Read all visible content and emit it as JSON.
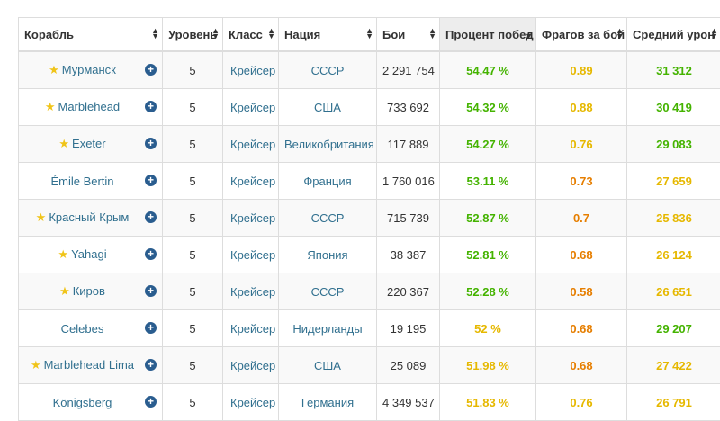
{
  "headers": {
    "ship": "Корабль",
    "level": "Уровень",
    "class": "Класс",
    "nation": "Нация",
    "battles": "Бои",
    "winrate": "Процент побед",
    "frags": "Фрагов за бой",
    "avgdmg": "Средний урон"
  },
  "colors": {
    "green": "#44b300",
    "yellow": "#e6b800",
    "orange": "#e67e00",
    "link": "#31708f",
    "star": "#f0c419",
    "plus": "#2a5d8f"
  },
  "rows": [
    {
      "premium": true,
      "ship": "Мурманск",
      "level": "5",
      "class": "Крейсер",
      "nation": "СССР",
      "battles": "2 291 754",
      "winrate": "54.47 %",
      "winrate_color": "green",
      "frags": "0.89",
      "frags_color": "yellow",
      "avgdmg": "31 312",
      "avgdmg_color": "green"
    },
    {
      "premium": true,
      "ship": "Marblehead",
      "level": "5",
      "class": "Крейсер",
      "nation": "США",
      "battles": "733 692",
      "winrate": "54.32 %",
      "winrate_color": "green",
      "frags": "0.88",
      "frags_color": "yellow",
      "avgdmg": "30 419",
      "avgdmg_color": "green"
    },
    {
      "premium": true,
      "ship": "Exeter",
      "level": "5",
      "class": "Крейсер",
      "nation": "Великобритания",
      "battles": "117 889",
      "winrate": "54.27 %",
      "winrate_color": "green",
      "frags": "0.76",
      "frags_color": "yellow",
      "avgdmg": "29 083",
      "avgdmg_color": "green"
    },
    {
      "premium": false,
      "ship": "Émile Bertin",
      "level": "5",
      "class": "Крейсер",
      "nation": "Франция",
      "battles": "1 760 016",
      "winrate": "53.11 %",
      "winrate_color": "green",
      "frags": "0.73",
      "frags_color": "orange",
      "avgdmg": "27 659",
      "avgdmg_color": "yellow"
    },
    {
      "premium": true,
      "ship": "Красный Крым",
      "level": "5",
      "class": "Крейсер",
      "nation": "СССР",
      "battles": "715 739",
      "winrate": "52.87 %",
      "winrate_color": "green",
      "frags": "0.7",
      "frags_color": "orange",
      "avgdmg": "25 836",
      "avgdmg_color": "yellow"
    },
    {
      "premium": true,
      "ship": "Yahagi",
      "level": "5",
      "class": "Крейсер",
      "nation": "Япония",
      "battles": "38 387",
      "winrate": "52.81 %",
      "winrate_color": "green",
      "frags": "0.68",
      "frags_color": "orange",
      "avgdmg": "26 124",
      "avgdmg_color": "yellow"
    },
    {
      "premium": true,
      "ship": "Киров",
      "level": "5",
      "class": "Крейсер",
      "nation": "СССР",
      "battles": "220 367",
      "winrate": "52.28 %",
      "winrate_color": "green",
      "frags": "0.58",
      "frags_color": "orange",
      "avgdmg": "26 651",
      "avgdmg_color": "yellow"
    },
    {
      "premium": false,
      "ship": "Celebes",
      "level": "5",
      "class": "Крейсер",
      "nation": "Нидерланды",
      "battles": "19 195",
      "winrate": "52 %",
      "winrate_color": "yellow",
      "frags": "0.68",
      "frags_color": "orange",
      "avgdmg": "29 207",
      "avgdmg_color": "green"
    },
    {
      "premium": true,
      "ship": "Marblehead Lima",
      "level": "5",
      "class": "Крейсер",
      "nation": "США",
      "battles": "25 089",
      "winrate": "51.98 %",
      "winrate_color": "yellow",
      "frags": "0.68",
      "frags_color": "orange",
      "avgdmg": "27 422",
      "avgdmg_color": "yellow"
    },
    {
      "premium": false,
      "ship": "Königsberg",
      "level": "5",
      "class": "Крейсер",
      "nation": "Германия",
      "battles": "4 349 537",
      "winrate": "51.83 %",
      "winrate_color": "yellow",
      "frags": "0.76",
      "frags_color": "yellow",
      "avgdmg": "26 791",
      "avgdmg_color": "yellow"
    }
  ]
}
